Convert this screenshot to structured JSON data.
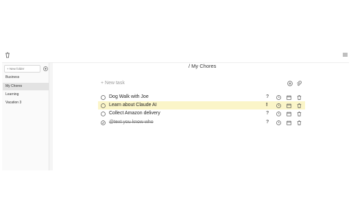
{
  "sidebar": {
    "new_folder_placeholder": "+ New folder",
    "folders": [
      {
        "label": "Business",
        "active": false
      },
      {
        "label": "My Chores",
        "active": true
      },
      {
        "label": "Learning",
        "active": false
      },
      {
        "label": "Vacation 3",
        "active": false
      }
    ]
  },
  "main": {
    "list_title": "/ My Chores",
    "new_task_label": "+ New task",
    "tasks": [
      {
        "label": "Dog Walk with Joe",
        "priority": "?",
        "completed": false,
        "highlighted": false
      },
      {
        "label": "Learn about Claude AI",
        "priority": "!",
        "completed": false,
        "highlighted": true
      },
      {
        "label": "Collect Amazon delivery",
        "priority": "?",
        "completed": false,
        "highlighted": false
      },
      {
        "label": "@text you know who",
        "priority": "?",
        "completed": true,
        "highlighted": false
      }
    ]
  },
  "colors": {
    "highlight": "#fbf5c8",
    "active_folder": "#e3e3e3",
    "icon_stroke": "#555555"
  },
  "icons": {
    "top_left": "trash-icon",
    "top_right": "hamburger-menu-icon",
    "add": "plus-circle-icon",
    "link": "paperclip-icon",
    "clock": "clock-icon",
    "calendar": "calendar-icon",
    "delete": "trash-icon"
  }
}
